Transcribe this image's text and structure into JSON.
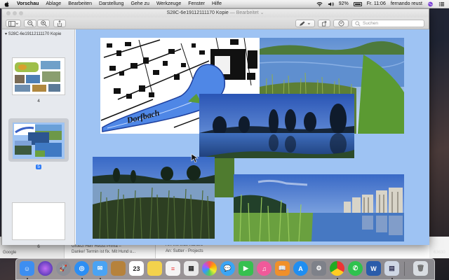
{
  "menubar": {
    "app_name": "Vorschau",
    "items": [
      "Ablage",
      "Bearbeiten",
      "Darstellung",
      "Gehe zu",
      "Werkzeuge",
      "Fenster",
      "Hilfe"
    ],
    "battery": "92%",
    "clock": "Fr. 11:06",
    "user": "fernando reust"
  },
  "window": {
    "title": "S28C-6e19112111170 Kopie",
    "title_suffix": "— Bearbeitet",
    "search_placeholder": "Suchen"
  },
  "sidebar": {
    "doc_title": "S28C-6e19112111170 Kopie",
    "pages": [
      {
        "number": "4",
        "selected": false
      },
      {
        "number": "5",
        "selected": true
      },
      {
        "number": "6",
        "selected": false
      }
    ]
  },
  "document": {
    "map_label": "Dorfbach"
  },
  "background_window": {
    "left_label": "Google",
    "mail_line_1": "Grüezi Herr Reust Prima –",
    "mail_line_2": "Danke! Termin ist fix. Mit Hund u...",
    "mail_to_1": "An: Ink Inde Kandro",
    "mail_to_2": "An: Sutter - Projects",
    "corner_label": "63630"
  },
  "dock": {
    "calendar_date": "23",
    "apps": [
      {
        "name": "finder",
        "color": "#3d8ef0"
      },
      {
        "name": "siri",
        "color": "#6b3fd6"
      },
      {
        "name": "launchpad",
        "color": "#8c8f98"
      },
      {
        "name": "safari",
        "color": "#2d8ef3"
      },
      {
        "name": "mail",
        "color": "#4aa3f3"
      },
      {
        "name": "notes-brown",
        "color": "#b6823c"
      },
      {
        "name": "calendar",
        "color": "#ffffff"
      },
      {
        "name": "notes",
        "color": "#f3d24c"
      },
      {
        "name": "reminders",
        "color": "#f4f4f4"
      },
      {
        "name": "photo-booth",
        "color": "#e9e9e9"
      },
      {
        "name": "photos",
        "color": "#f6f6f6"
      },
      {
        "name": "messages-blue",
        "color": "#3aa5f5"
      },
      {
        "name": "facetime",
        "color": "#37c04f"
      },
      {
        "name": "itunes",
        "color": "#f05a9a"
      },
      {
        "name": "ibooks",
        "color": "#f0902a"
      },
      {
        "name": "app-store",
        "color": "#1f8ef1"
      },
      {
        "name": "system-preferences",
        "color": "#7e8189"
      },
      {
        "name": "chrome",
        "color": "#f2f2f2"
      },
      {
        "name": "whatsapp",
        "color": "#2fc24e"
      },
      {
        "name": "word",
        "color": "#2a5caa"
      },
      {
        "name": "preview",
        "color": "#cfd7e4"
      },
      {
        "name": "trash",
        "color": "#d9dde2"
      }
    ]
  },
  "colors": {
    "doc_background": "#9ec3f3",
    "selection_accent": "#2f7cf6"
  }
}
